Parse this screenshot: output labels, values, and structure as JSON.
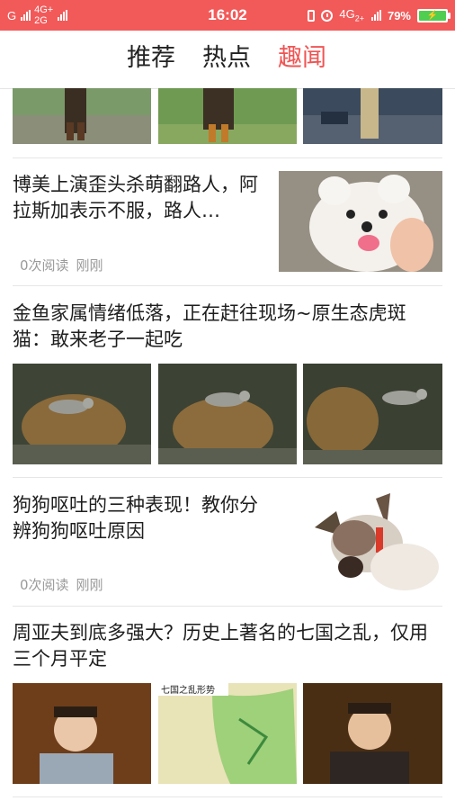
{
  "status_bar": {
    "carrier_g": "G",
    "net1": "4G+",
    "net2": "2G",
    "time": "16:02",
    "net3": "4G",
    "net3_sub": "2+",
    "battery_pct": "79%",
    "battery_level": 0.79,
    "icons": [
      "signal-icon",
      "vibrate-icon",
      "alarm-icon",
      "battery-icon"
    ]
  },
  "tabs": [
    {
      "label": "推荐",
      "active": false
    },
    {
      "label": "热点",
      "active": false
    },
    {
      "label": "趣闻",
      "active": true
    }
  ],
  "articles": [
    {
      "title": "",
      "images": [
        "game-character-scene",
        "game-character-scene",
        "game-character-scene"
      ]
    },
    {
      "title": "博美上演歪头杀萌翻路人，阿拉斯加表示不服，路人…",
      "reads": "0次阅读",
      "time": "刚刚",
      "image": "pomeranian-dog"
    },
    {
      "title": "金鱼家属情绪低落，正在赶往现场~原生态虎斑猫：敢来老子一起吃",
      "images": [
        "tabby-cat-on-rock",
        "tabby-cat-on-rock",
        "tabby-cat-on-rock"
      ]
    },
    {
      "title": "狗狗呕吐的三种表现！教你分辨狗狗呕吐原因",
      "reads": "0次阅读",
      "time": "刚刚",
      "image": "dog-with-red-collar"
    },
    {
      "title": "周亚夫到底多强大？历史上著名的七国之乱，仅用三个月平定",
      "images": [
        "drama-actor-portrait",
        "seven-states-rebellion-map",
        "drama-actor-portrait"
      ],
      "map_title": "七国之乱形势"
    }
  ],
  "colors": {
    "accent": "#f05454",
    "status_bar": "#f25a5a",
    "meta": "#9a9a9a"
  }
}
